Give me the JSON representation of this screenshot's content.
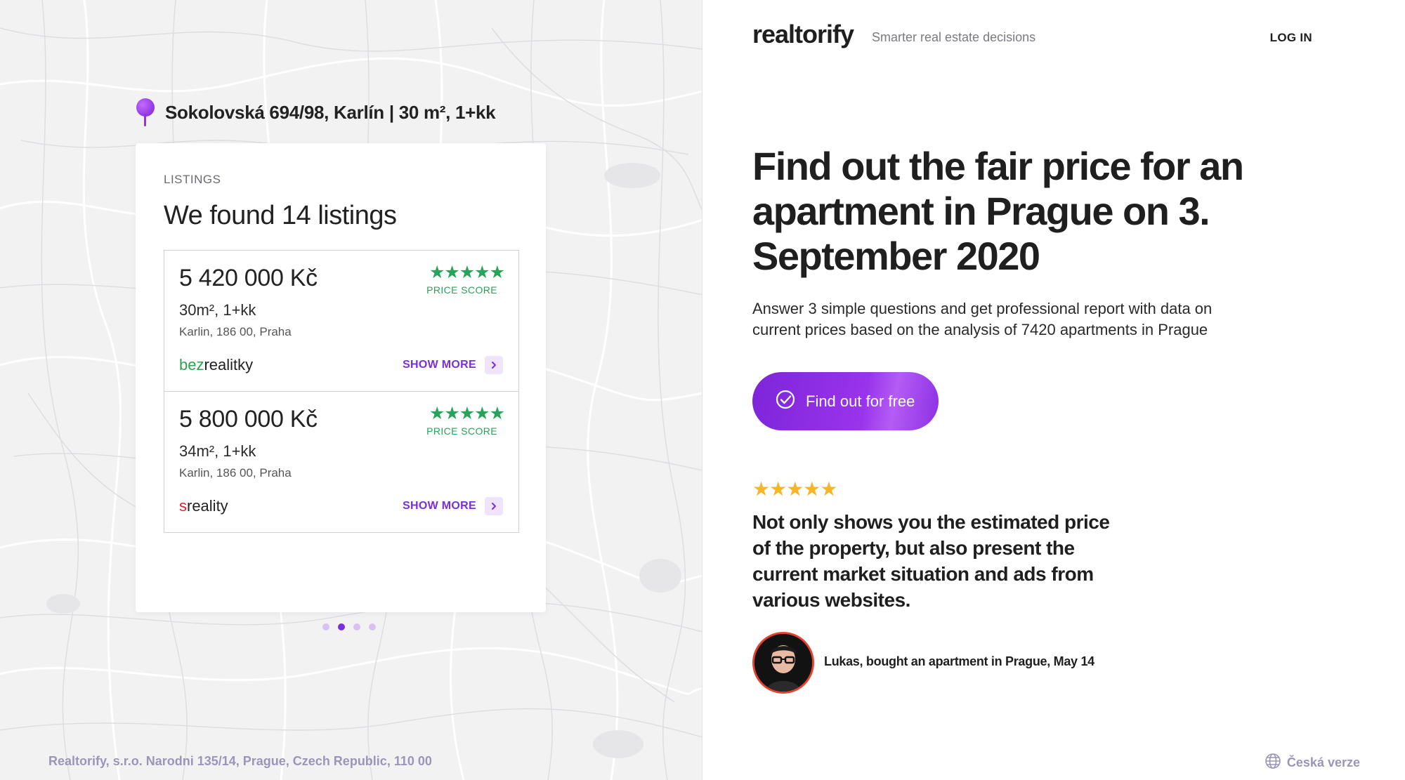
{
  "location": {
    "text": "Sokolovská 694/98, Karlín | 30 m², 1+kk",
    "icon": "map-pin-icon"
  },
  "listings_card": {
    "label": "LISTINGS",
    "title": "We found 14 listings",
    "items": [
      {
        "price": "5 420 000 Kč",
        "stars": "★★★★★",
        "score_label": "PRICE SCORE",
        "specs": "30m², 1+kk",
        "address": "Karlin, 186 00, Praha",
        "source_prefix": "bez",
        "source_suffix": "realitky",
        "show_more": "SHOW MORE"
      },
      {
        "price": "5 800 000 Kč",
        "stars": "★★★★★",
        "score_label": "PRICE SCORE",
        "specs": "34m², 1+kk",
        "address": "Karlin, 186 00, Praha",
        "source_prefix": "s",
        "source_suffix": "reality",
        "show_more": "SHOW MORE"
      }
    ],
    "carousel": {
      "total": 4,
      "active_index": 1
    }
  },
  "footer": {
    "address": "Realtorify, s.r.o. Narodni 135/14, Prague, Czech Republic, 110 00"
  },
  "header": {
    "logo": "realtorify",
    "tagline": "Smarter real estate decisions",
    "login": "LOG IN"
  },
  "hero": {
    "headline": "Find out the fair price for an apartment in Prague on 3. September 2020",
    "subtext": "Answer 3 simple questions and get professional report with data on current prices based on the analysis of 7420 apartments in Prague",
    "cta_label": "Find out for free",
    "cta_icon": "check-circle-icon"
  },
  "testimonial": {
    "stars": "★★★★★",
    "quote": "Not only shows you the estimated price of the property, but also present the current market situation and ads from various websites.",
    "reviewer": "Lukas, bought an apartment in Prague, May 14"
  },
  "language": {
    "label": "Česká verze",
    "icon": "globe-icon"
  },
  "colors": {
    "accent": "#7b2fd6",
    "score_green": "#27a35a",
    "rating_gold": "#f6b52b",
    "map_bg": "#f2f2f3",
    "muted": "#9b96b9"
  }
}
